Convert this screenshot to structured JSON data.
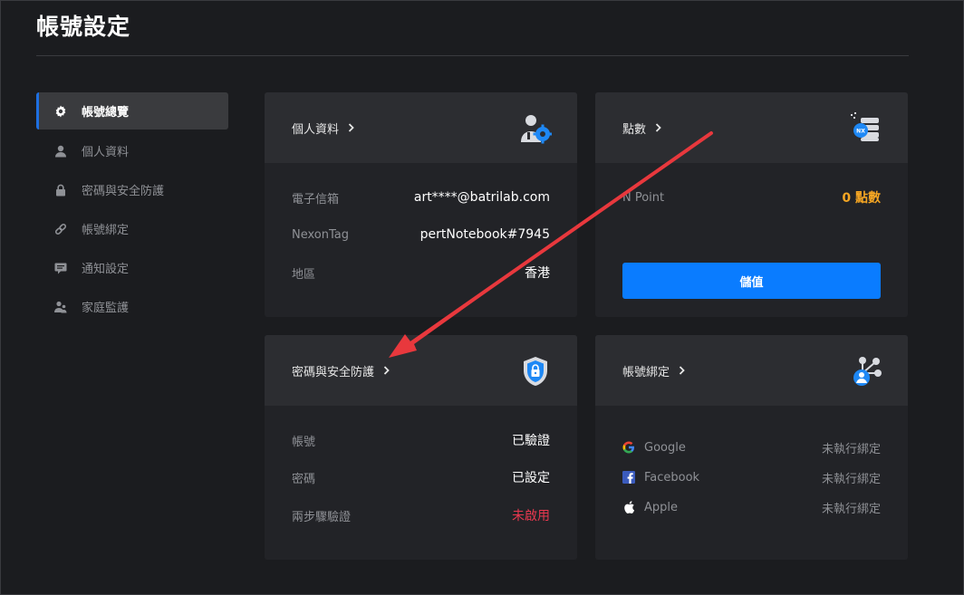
{
  "page": {
    "title": "帳號設定"
  },
  "sidebar": {
    "items": [
      {
        "label": "帳號總覽",
        "icon": "gear-icon",
        "active": true
      },
      {
        "label": "個人資料",
        "icon": "person-icon"
      },
      {
        "label": "密碼與安全防護",
        "icon": "lock-icon"
      },
      {
        "label": "帳號綁定",
        "icon": "link-icon"
      },
      {
        "label": "通知設定",
        "icon": "message-icon"
      },
      {
        "label": "家庭監護",
        "icon": "family-icon"
      }
    ]
  },
  "profile_card": {
    "title": "個人資料",
    "icon": "user-gear-icon",
    "rows": [
      {
        "key": "電子信箱",
        "value": "art****@batrilab.com"
      },
      {
        "key": "NexonTag",
        "value": "pertNotebook#7945"
      },
      {
        "key": "地區",
        "value": "香港"
      }
    ]
  },
  "points_card": {
    "title": "點數",
    "icon": "nx-coin-icon",
    "row": {
      "key": "N Point",
      "value": "0 點數"
    },
    "button_label": "儲值"
  },
  "security_card": {
    "title": "密碼與安全防護",
    "icon": "shield-lock-icon",
    "rows": [
      {
        "key": "帳號",
        "value": "已驗證"
      },
      {
        "key": "密碼",
        "value": "已設定"
      },
      {
        "key": "兩步驟驗證",
        "value": "未啟用"
      }
    ]
  },
  "binding_card": {
    "title": "帳號綁定",
    "icon": "share-user-icon",
    "rows": [
      {
        "key": "Google",
        "icon": "google-icon",
        "value": "未執行綁定"
      },
      {
        "key": "Facebook",
        "icon": "facebook-icon",
        "value": "未執行綁定"
      },
      {
        "key": "Apple",
        "icon": "apple-icon",
        "value": "未執行綁定"
      }
    ]
  },
  "colors": {
    "accent": "#0a7cff",
    "annotation_arrow": "#e8383d",
    "warning": "#e8384f",
    "points": "#f5a623"
  }
}
